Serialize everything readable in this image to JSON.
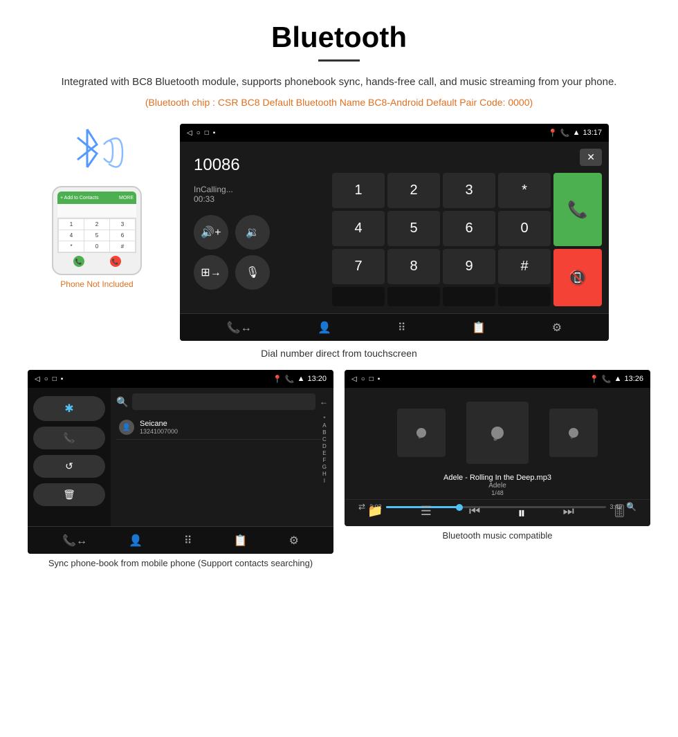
{
  "page": {
    "title": "Bluetooth",
    "intro": "Integrated with BC8 Bluetooth module, supports phonebook sync, hands-free call, and music streaming from your phone.",
    "orange_note": "(Bluetooth chip : CSR BC8    Default Bluetooth Name BC8-Android    Default Pair Code: 0000)",
    "dial_caption": "Dial number direct from touchscreen",
    "phonebook_caption": "Sync phone-book from mobile phone\n(Support contacts searching)",
    "music_caption": "Bluetooth music compatible"
  },
  "dial_screen": {
    "status_bar_time": "13:17",
    "number": "10086",
    "status": "InCalling...",
    "timer": "00:33",
    "keys": [
      "1",
      "2",
      "3",
      "*",
      "4",
      "5",
      "6",
      "0",
      "7",
      "8",
      "9",
      "#"
    ]
  },
  "phonebook_screen": {
    "status_bar_time": "13:20",
    "contact_name": "Seicane",
    "contact_number": "13241007000",
    "alphabet": [
      "*",
      "A",
      "B",
      "C",
      "D",
      "E",
      "F",
      "G",
      "H",
      "I"
    ]
  },
  "music_screen": {
    "status_bar_time": "13:26",
    "song_title": "Adele - Rolling In the Deep.mp3",
    "artist": "Adele",
    "track_count": "1/48",
    "time_current": "2:02",
    "time_total": "3:49"
  },
  "phone_mockup": {
    "keys": [
      "1",
      "2",
      "3",
      "4",
      "5",
      "6",
      "*",
      "0",
      "#"
    ],
    "not_included": "Phone Not Included"
  }
}
